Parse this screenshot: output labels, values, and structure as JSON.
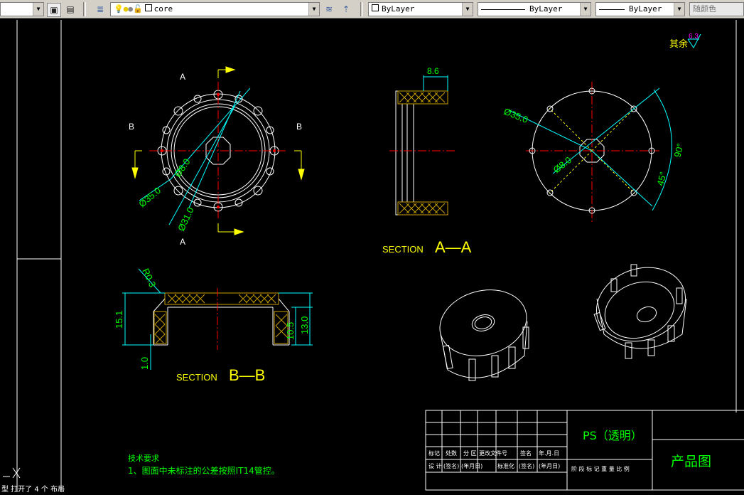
{
  "toolbar": {
    "layer_name": "core",
    "color_value": "ByLayer",
    "linetype_value": "ByLayer",
    "lineweight_value": "ByLayer",
    "plotstyle_value": "随颜色"
  },
  "drawing": {
    "roughness_label": "其余",
    "roughness_value": "6.3",
    "section_aa_label": "SECTION",
    "section_aa_name": "A—A",
    "section_bb_label": "SECTION",
    "section_bb_name": "B—B",
    "cut_labels": [
      "A",
      "A",
      "B",
      "B"
    ],
    "dims_front": [
      "Ø8.0",
      "Ø35.0",
      "Ø31.0"
    ],
    "dims_aa": [
      "8.6"
    ],
    "dims_right": [
      "Ø35.0",
      "Ø8.0",
      "90°",
      "45°"
    ],
    "dims_bb": [
      "R0.3",
      "15.1",
      "1.0",
      "10.5",
      "13.0"
    ],
    "tech_title": "技术要求",
    "tech_note": "1、图面中未标注的公差按照IT14管控。"
  },
  "title_block": {
    "material": "PS（透明）",
    "drawing_type": "产品图",
    "row1": [
      "标记",
      "处数",
      "分 区",
      "更改文件号",
      "签名",
      "年.月.日"
    ],
    "row2": [
      "设 计",
      "(签名)",
      "(年月日)",
      "标准化",
      "(签名)",
      "(年月日)"
    ],
    "row3": "阶 段 标 记   重 量   比 例"
  },
  "statusbar": {
    "prompt": "型   打开了 4 个 布局"
  }
}
